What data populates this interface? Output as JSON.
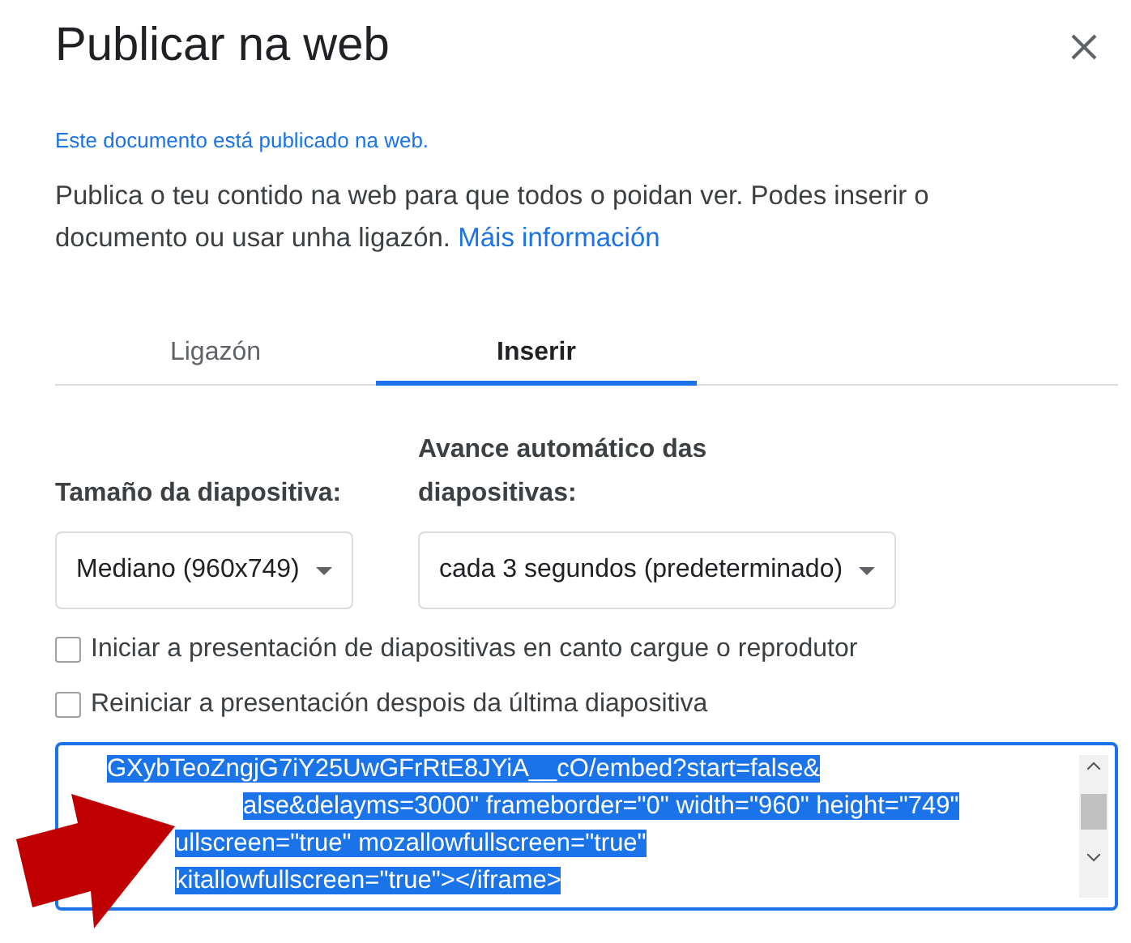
{
  "dialog": {
    "title": "Publicar na web",
    "status": "Este documento está publicado na web.",
    "description": "Publica o teu contido na web para que todos o poidan ver. Podes inserir o documento ou usar unha ligazón.",
    "learn_more_link": "Máis información"
  },
  "tabs": [
    {
      "label": "Ligazón",
      "selected": false
    },
    {
      "label": "Inserir",
      "selected": true
    }
  ],
  "settings": [
    {
      "label": "Tamaño da diapositiva:",
      "value": "Mediano (960x749)"
    },
    {
      "label": "Avance automático das diapositivas:",
      "value": "cada 3 segundos (predeterminado)"
    }
  ],
  "options": [
    {
      "label": "Iniciar a presentación de diapositivas en canto cargue o reprodutor",
      "checked": false
    },
    {
      "label": "Reiniciar a presentación despois da última diapositiva",
      "checked": false
    }
  ],
  "embed_code": {
    "selected": true,
    "lines": [
      "GXybTeoZngjG7iY25UwGFrRtE8JYiA__cO/embed?start=false&",
      "alse&delayms=3000\" frameborder=\"0\" width=\"960\" height=\"749\"",
      "ullscreen=\"true\" mozallowfullscreen=\"true\"",
      "kitallowfullscreen=\"true\"></iframe>"
    ]
  }
}
